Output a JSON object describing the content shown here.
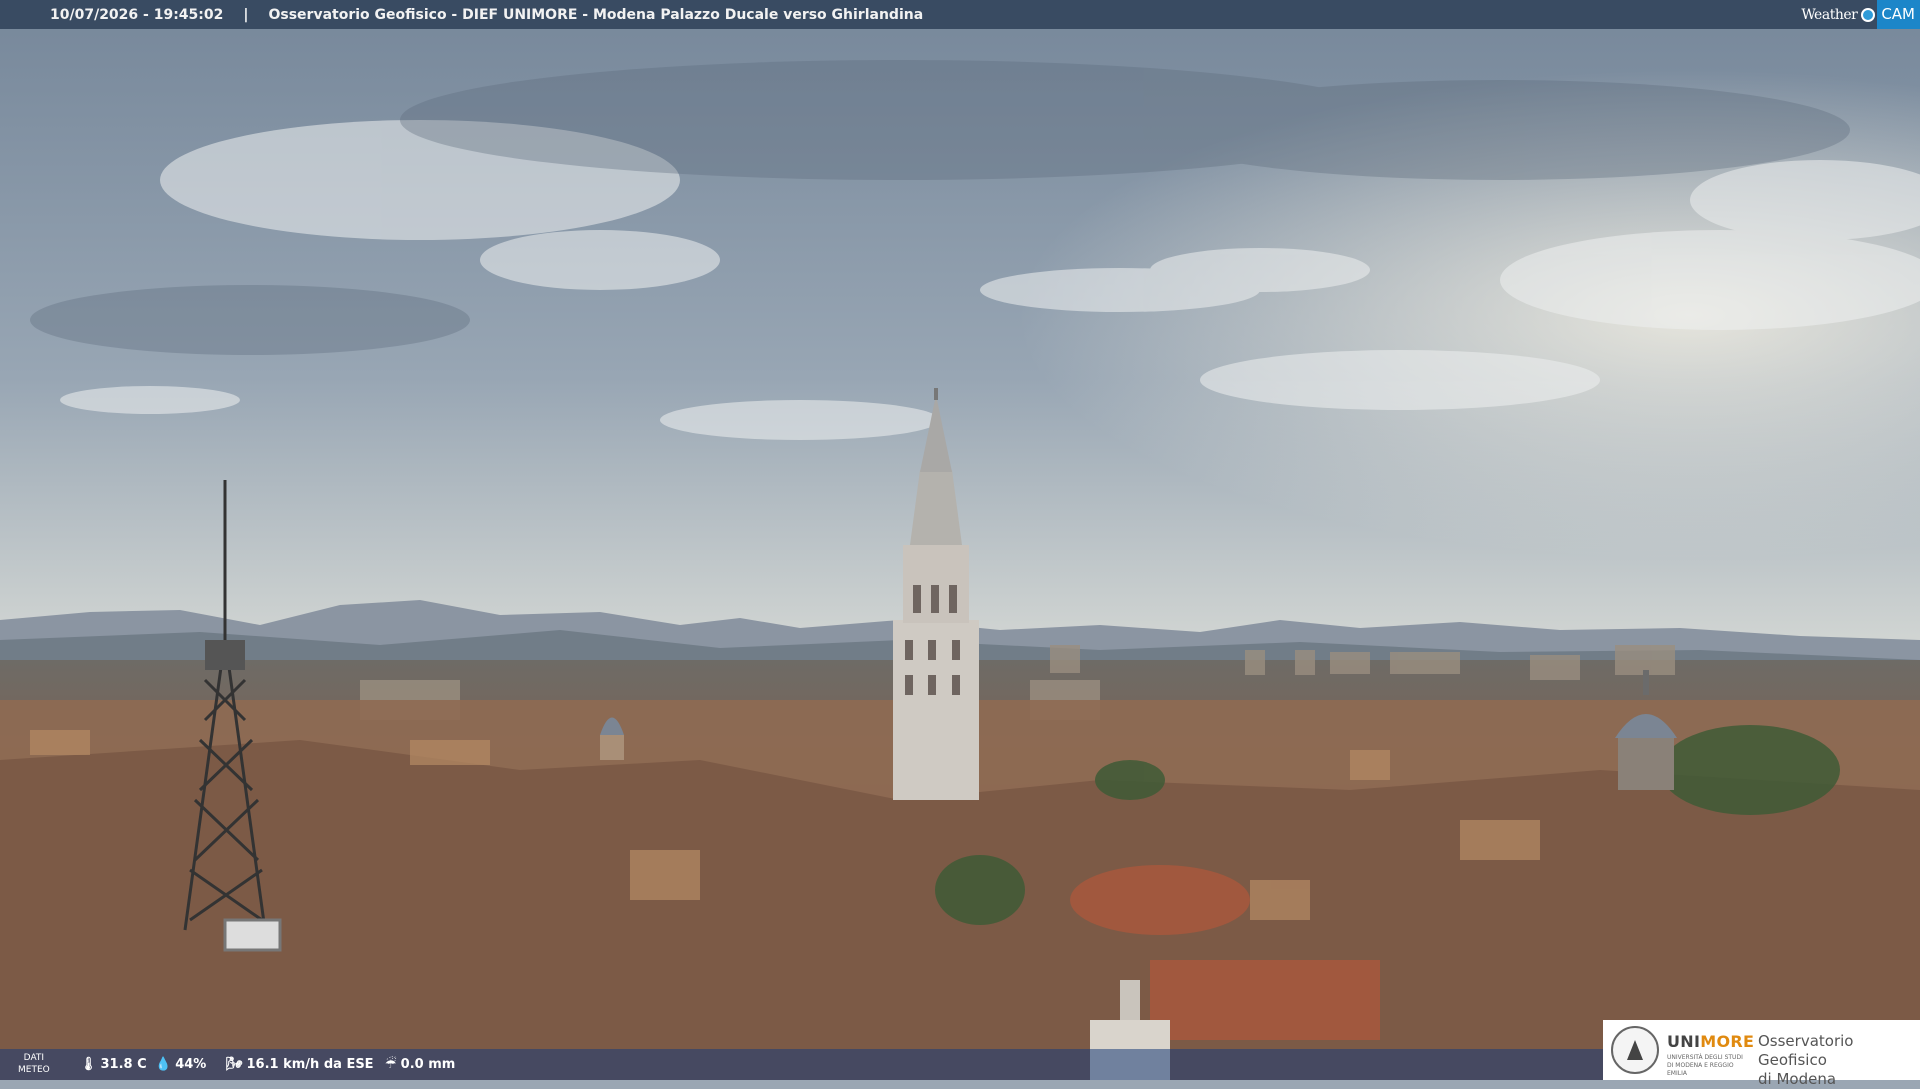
{
  "header": {
    "timestamp": "10/07/2026 - 19:45:02",
    "separator": "|",
    "title": "Osservatorio Geofisico - DIEF UNIMORE - Modena Palazzo Ducale verso Ghirlandina",
    "brand_weather": "Weather",
    "brand_cam": "CAM"
  },
  "weather": {
    "label_line1": "DATI",
    "label_line2": "METEO",
    "temperature": "31.8 C",
    "humidity": "44%",
    "wind": "16.1 km/h da ESE",
    "rain": "0.0 mm"
  },
  "logo": {
    "uni_a": "UNI",
    "uni_b": "MORE",
    "uni_sub": "UNIVERSITÀ DEGLI STUDI DI MODENA E REGGIO EMILIA",
    "obs_line1": "Osservatorio Geofisico",
    "obs_line2": "di Modena"
  },
  "colors": {
    "sky_top": "#7f8fa0",
    "sky_horizon": "#dfe1dd",
    "roof": "#8a6a55",
    "brand_cam": "#1c86c9",
    "unimore_orange": "#e08a10"
  }
}
